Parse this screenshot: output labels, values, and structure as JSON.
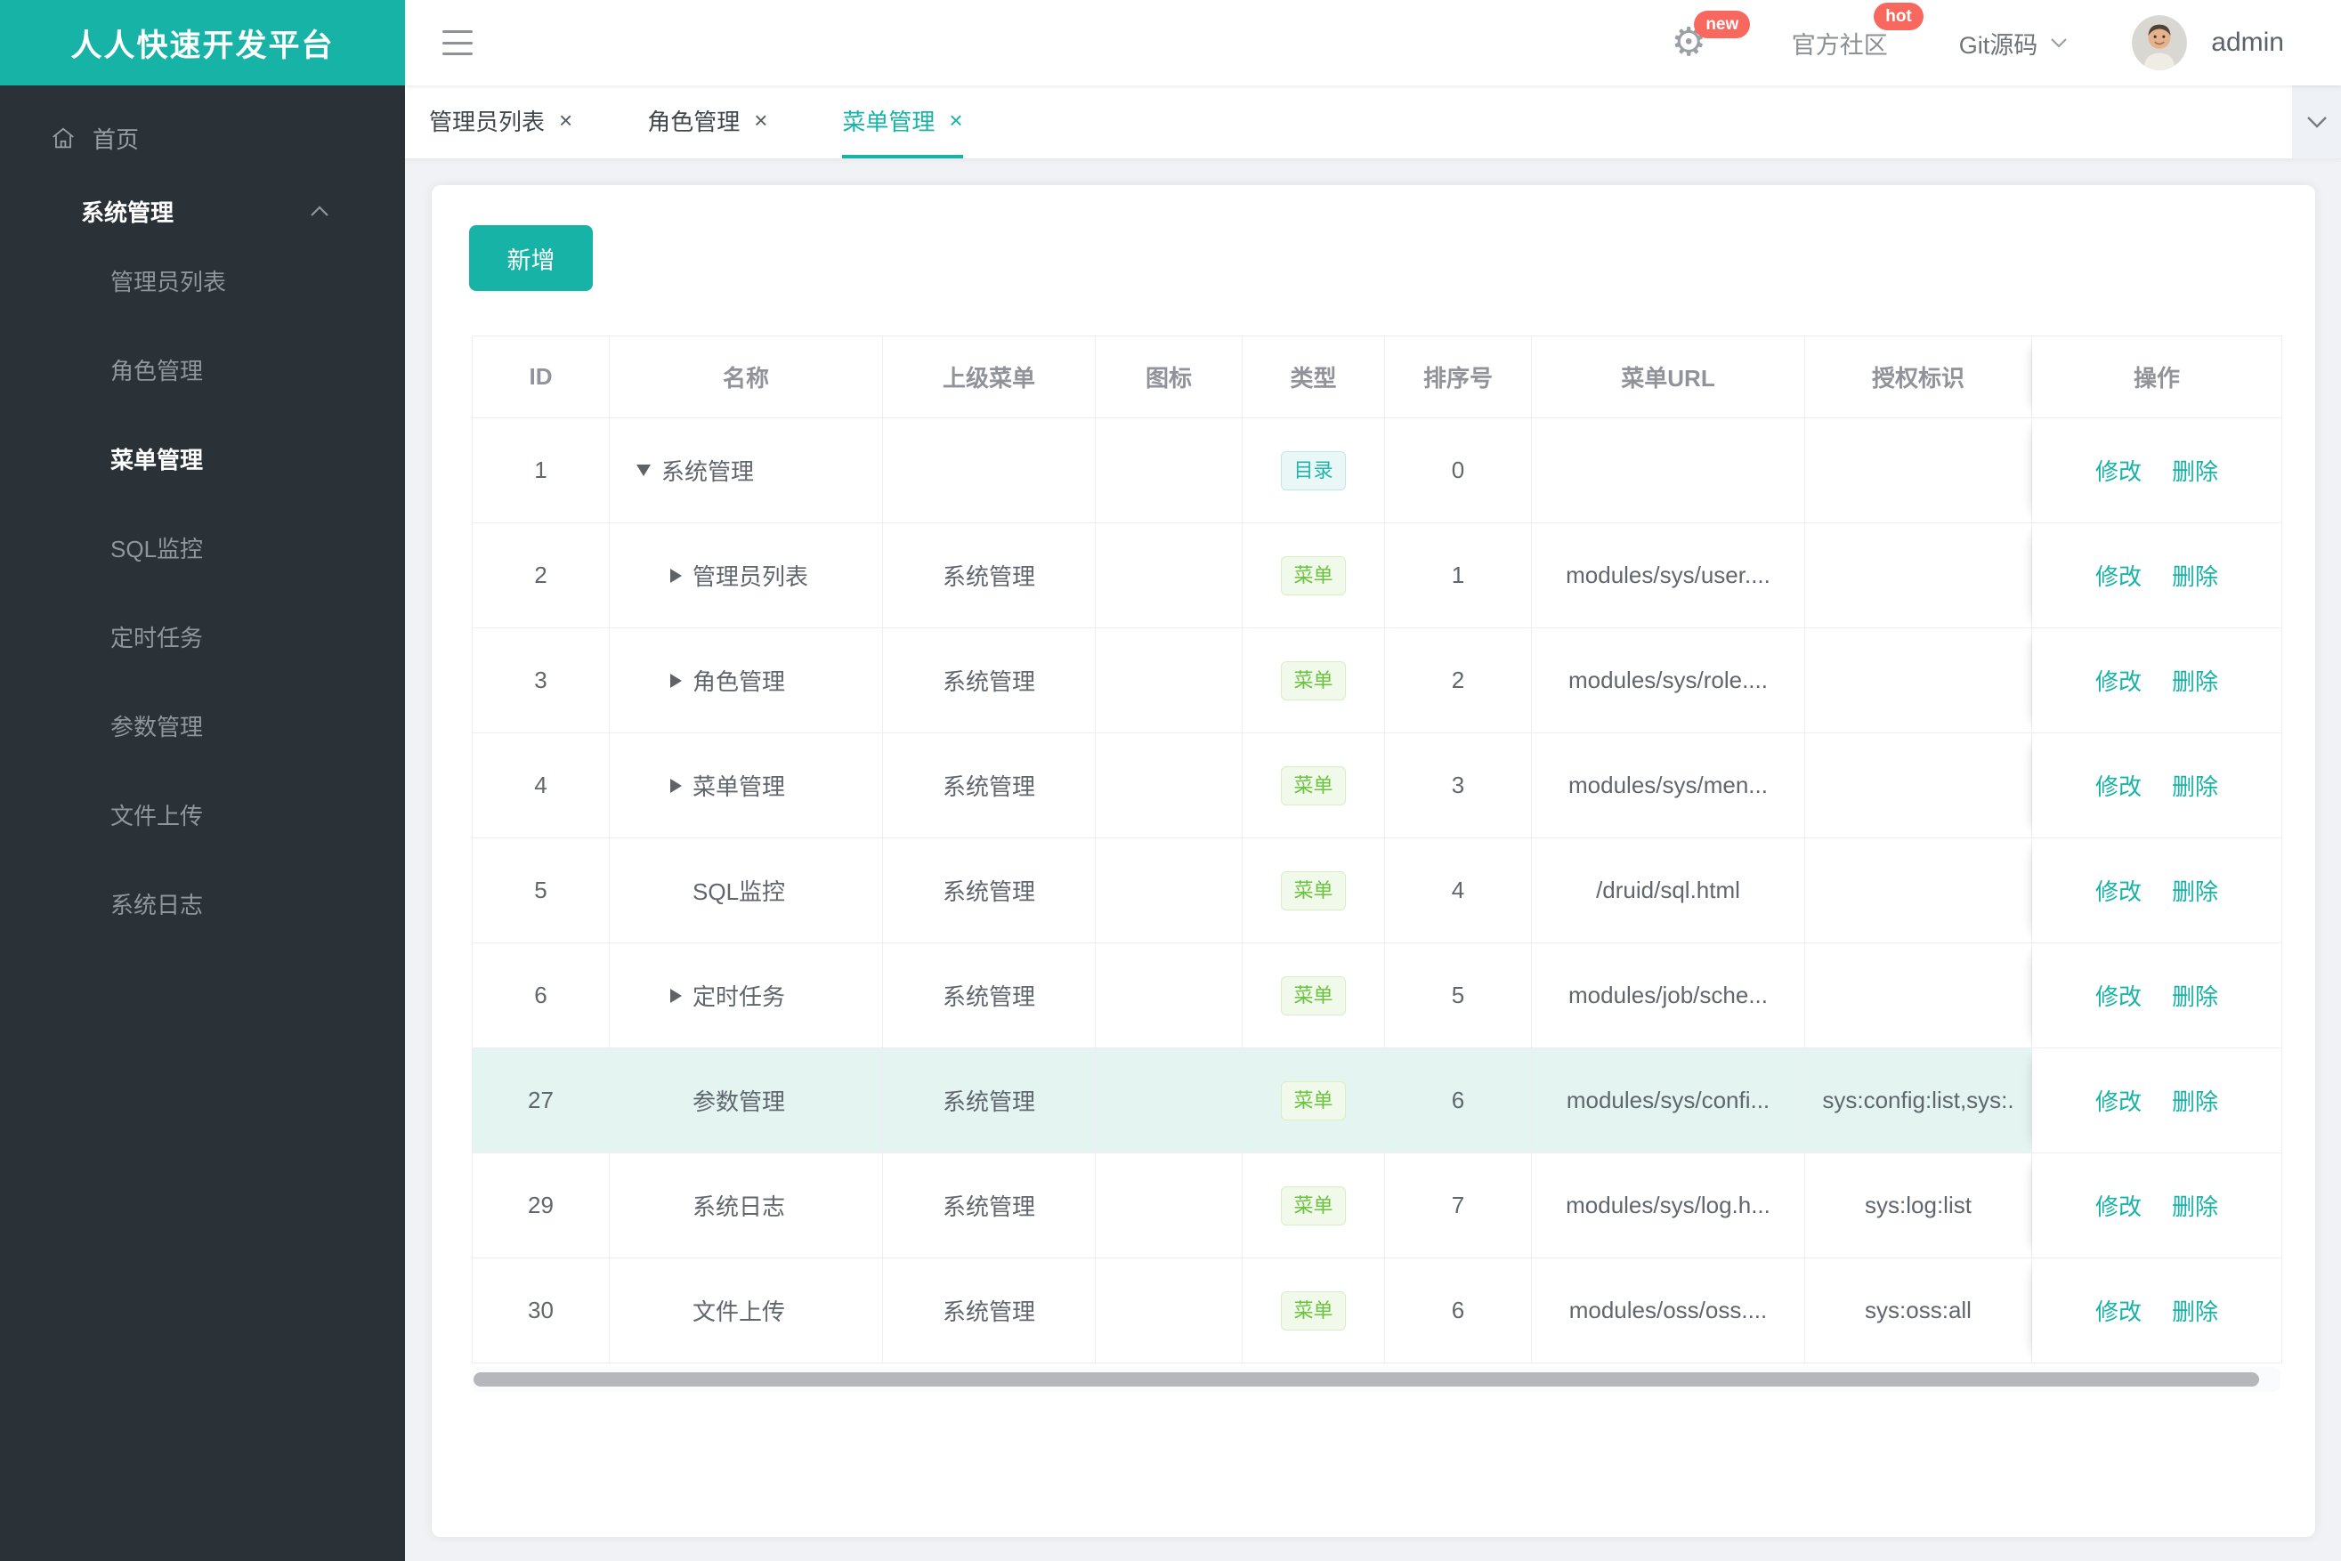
{
  "app": {
    "title": "人人快速开发平台"
  },
  "colors": {
    "accent": "#17b3a6",
    "badge_red": "#f8685e",
    "sidebar_bg": "#2a3137",
    "content_bg": "#f0f2f5",
    "row_highlight": "#e4f5f1",
    "tag_dir": {
      "text": "#21b5aa",
      "bg": "#e9f8f6",
      "border": "#bfe8e4"
    },
    "tag_menu": {
      "text": "#69c33c",
      "bg": "#f0f9ea",
      "border": "#d6efc5"
    }
  },
  "topbar": {
    "settings_badge": "new",
    "community_label": "官方社区",
    "community_badge": "hot",
    "git_label": "Git源码",
    "user_label": "admin"
  },
  "sidebar": {
    "home_label": "首页",
    "section_label": "系统管理",
    "items": [
      {
        "label": "管理员列表",
        "active": false
      },
      {
        "label": "角色管理",
        "active": false
      },
      {
        "label": "菜单管理",
        "active": true
      },
      {
        "label": "SQL监控",
        "active": false
      },
      {
        "label": "定时任务",
        "active": false
      },
      {
        "label": "参数管理",
        "active": false
      },
      {
        "label": "文件上传",
        "active": false
      },
      {
        "label": "系统日志",
        "active": false
      }
    ]
  },
  "tabs": [
    {
      "label": "管理员列表",
      "active": false
    },
    {
      "label": "角色管理",
      "active": false
    },
    {
      "label": "菜单管理",
      "active": true
    }
  ],
  "icons": {
    "close_glyph": "×",
    "gear_glyph": "⚙"
  },
  "toolbar": {
    "add_label": "新增"
  },
  "table": {
    "columns": [
      "ID",
      "名称",
      "上级菜单",
      "图标",
      "类型",
      "排序号",
      "菜单URL",
      "授权标识",
      "操作"
    ],
    "actions": {
      "edit": "修改",
      "delete": "删除"
    },
    "rows": [
      {
        "id": "1",
        "name": "系统管理",
        "arrow": "down",
        "level": 0,
        "parent": "",
        "icon": "",
        "type": "目录",
        "type_kind": "dir",
        "order": "0",
        "url": "",
        "perm": "",
        "highlight": false
      },
      {
        "id": "2",
        "name": "管理员列表",
        "arrow": "right",
        "level": 1,
        "parent": "系统管理",
        "icon": "",
        "type": "菜单",
        "type_kind": "menu",
        "order": "1",
        "url": "modules/sys/user....",
        "perm": "",
        "highlight": false
      },
      {
        "id": "3",
        "name": "角色管理",
        "arrow": "right",
        "level": 1,
        "parent": "系统管理",
        "icon": "",
        "type": "菜单",
        "type_kind": "menu",
        "order": "2",
        "url": "modules/sys/role....",
        "perm": "",
        "highlight": false
      },
      {
        "id": "4",
        "name": "菜单管理",
        "arrow": "right",
        "level": 1,
        "parent": "系统管理",
        "icon": "",
        "type": "菜单",
        "type_kind": "menu",
        "order": "3",
        "url": "modules/sys/men...",
        "perm": "",
        "highlight": false
      },
      {
        "id": "5",
        "name": "SQL监控",
        "arrow": "none",
        "level": 1,
        "parent": "系统管理",
        "icon": "",
        "type": "菜单",
        "type_kind": "menu",
        "order": "4",
        "url": "/druid/sql.html",
        "perm": "",
        "highlight": false
      },
      {
        "id": "6",
        "name": "定时任务",
        "arrow": "right",
        "level": 1,
        "parent": "系统管理",
        "icon": "",
        "type": "菜单",
        "type_kind": "menu",
        "order": "5",
        "url": "modules/job/sche...",
        "perm": "",
        "highlight": false
      },
      {
        "id": "27",
        "name": "参数管理",
        "arrow": "none",
        "level": 1,
        "parent": "系统管理",
        "icon": "",
        "type": "菜单",
        "type_kind": "menu",
        "order": "6",
        "url": "modules/sys/confi...",
        "perm": "sys:config:list,sys:.",
        "highlight": true
      },
      {
        "id": "29",
        "name": "系统日志",
        "arrow": "none",
        "level": 1,
        "parent": "系统管理",
        "icon": "",
        "type": "菜单",
        "type_kind": "menu",
        "order": "7",
        "url": "modules/sys/log.h...",
        "perm": "sys:log:list",
        "highlight": false
      },
      {
        "id": "30",
        "name": "文件上传",
        "arrow": "none",
        "level": 1,
        "parent": "系统管理",
        "icon": "",
        "type": "菜单",
        "type_kind": "menu",
        "order": "6",
        "url": "modules/oss/oss....",
        "perm": "sys:oss:all",
        "highlight": false
      }
    ]
  }
}
